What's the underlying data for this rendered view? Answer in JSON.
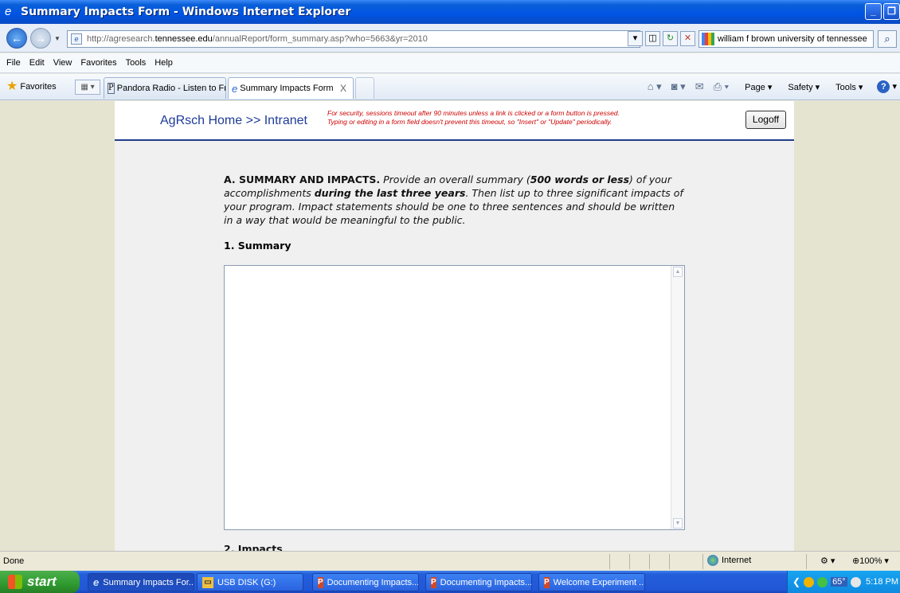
{
  "window": {
    "title": "Summary Impacts Form - Windows Internet Explorer"
  },
  "address": {
    "url_prefix": "http://agresearch.",
    "url_domain": "tennessee.edu",
    "url_path": "/annualReport/form_summary.asp?who=5663&yr=2010",
    "search_value": "william f brown university of tennessee"
  },
  "menu": [
    "File",
    "Edit",
    "View",
    "Favorites",
    "Tools",
    "Help"
  ],
  "favorites_label": "Favorites",
  "tabs": [
    {
      "label": "Pandora Radio - Listen to Fre...",
      "icon": "pandora-icon"
    },
    {
      "label": "Summary Impacts Form",
      "icon": "ie-page-icon",
      "close": "X"
    }
  ],
  "commands": {
    "page": "Page",
    "safety": "Safety",
    "tools": "Tools"
  },
  "page": {
    "brand": "AgRsch Home >> Intranet",
    "security_line1": "For security, sessions timeout after 90 minutes unless a link is clicked or a form button is pressed.",
    "security_line2": "Typing or editing in a form field doesn't prevent this timeout, so \"Insert\" or \"Update\" periodically.",
    "logoff": "Logoff",
    "section_lead": "A. SUMMARY AND IMPACTS.",
    "section_t1": " Provide an overall summary (",
    "section_b1": "500 words or less",
    "section_t2": ") of your accomplishments ",
    "section_b2": "during the last three years",
    "section_t3": ". Then list up to three significant impacts of your program. Impact statements should be one to three sentences and should be written in a way that would be meaningful to the public.",
    "summary_heading": "1. Summary",
    "summary_value": "",
    "impacts_heading": "2. Impacts"
  },
  "status": {
    "text": "Done",
    "zone": "Internet",
    "zoom": "100%"
  },
  "taskbar": {
    "start": "start",
    "buttons": [
      {
        "label": "Summary Impacts For...",
        "icon": "ie"
      },
      {
        "label": "USB DISK (G:)",
        "icon": "usb"
      },
      {
        "label": "Documenting Impacts...",
        "icon": "ppt"
      },
      {
        "label": "Documenting Impacts...",
        "icon": "ppt"
      },
      {
        "label": "Welcome Experiment ...",
        "icon": "ppt"
      }
    ],
    "temperature": "65°",
    "clock": "5:18 PM"
  }
}
